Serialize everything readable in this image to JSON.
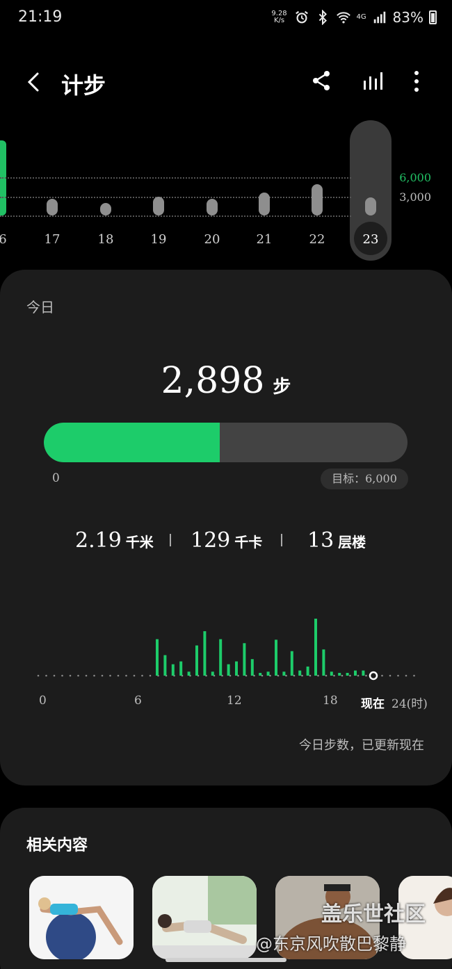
{
  "status_bar": {
    "time": "21:19",
    "net_speed_value": "9.28",
    "net_speed_unit": "K/s",
    "network_type": "4G",
    "battery": "83%",
    "icons": [
      "alarm-icon",
      "bluetooth-icon",
      "wifi-icon",
      "signal-icon",
      "battery-icon"
    ]
  },
  "header": {
    "title": "计步",
    "back_icon": "back-arrow-icon",
    "share_icon": "share-icon",
    "stats_icon": "bar-chart-icon",
    "more_icon": "more-vertical-icon"
  },
  "daily_chart": {
    "gridline_labels": [
      "6,000",
      "3,000"
    ],
    "partial_label": "6",
    "days": [
      {
        "label": "17",
        "level": 0.33
      },
      {
        "label": "18",
        "level": 0.25
      },
      {
        "label": "19",
        "level": 0.38
      },
      {
        "label": "20",
        "level": 0.33
      },
      {
        "label": "21",
        "level": 0.46
      },
      {
        "label": "22",
        "level": 0.63
      },
      {
        "label": "23",
        "level": 0.36,
        "selected": true
      }
    ],
    "colors": {
      "goal": "#21c064",
      "bar": "#8e8e8e"
    }
  },
  "today": {
    "label": "今日",
    "steps": "2,898",
    "steps_unit": "步",
    "progress_fraction": 0.483,
    "progress_min": "0",
    "goal": "目标：6,000",
    "metrics": [
      {
        "value": "2.19",
        "unit": "千米"
      },
      {
        "value": "129",
        "unit": "千卡"
      },
      {
        "value": "13",
        "unit": "层楼"
      }
    ],
    "hour_axis": [
      "0",
      "6",
      "12",
      "18"
    ],
    "now_label": "现在",
    "end_label": "24(时)",
    "hourly_levels": [
      0.64,
      0.36,
      0.2,
      0.25,
      0.07,
      0.53,
      0.78,
      0.07,
      0.64,
      0.2,
      0.25,
      0.57,
      0.29,
      0.02,
      0.07,
      0.63,
      0.07,
      0.43,
      0.09,
      0.16,
      1.0,
      0.46,
      0.07,
      0.02,
      0.02,
      0.09,
      0.09
    ],
    "updated_text": "今日步数，已更新现在",
    "colors": {
      "accent": "#1dcc6a",
      "track": "#434343"
    }
  },
  "related": {
    "title": "相关内容"
  },
  "watermark": {
    "line1": "盖乐世社区",
    "line2": "@东京风吹散巴黎静"
  }
}
